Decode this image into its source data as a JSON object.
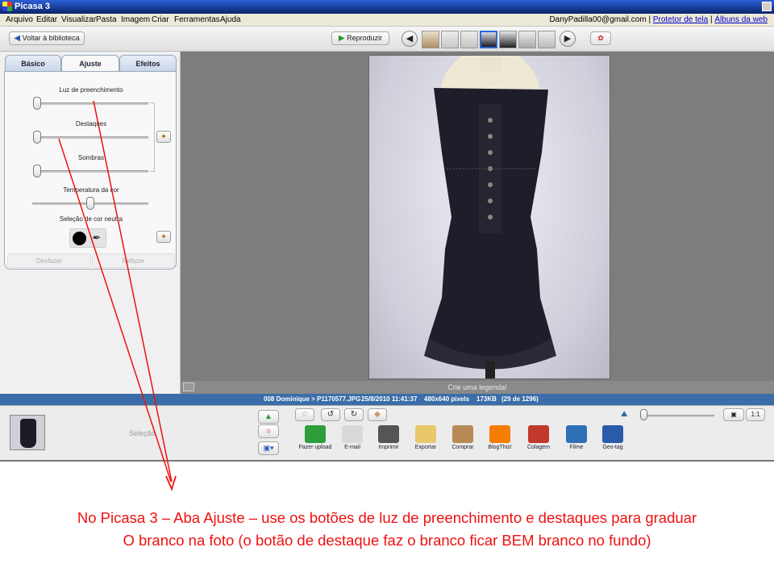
{
  "window": {
    "title": "Picasa 3"
  },
  "menu": {
    "items": [
      "Arquivo",
      "Editar",
      "Visualizar",
      "Pasta",
      "Imagem",
      "Criar",
      "Ferramentas",
      "Ajuda"
    ],
    "account": "DanyPadilla00@gmail.com",
    "screensaver_link": "Protetor de tela",
    "albums_link": "Álbuns da web",
    "separator": "|"
  },
  "toolbar": {
    "back_label": "Voltar à biblioteca",
    "play_label": "Reproduzir"
  },
  "tabs": [
    "Básico",
    "Ajuste",
    "Efeitos"
  ],
  "adjust": {
    "fill_light_label": "Luz de preenchimento",
    "highlights_label": "Destaques",
    "shadows_label": "Sombras",
    "temperature_label": "Temperatura da cor",
    "neutral_label": "Seleção de cor neutra",
    "undo_label": "Desfazer",
    "redo_label": "Refazer",
    "fill_light_value": 0.0,
    "highlights_value": 0.0,
    "shadows_value": 0.0,
    "temperature_value": 0.5
  },
  "caption": {
    "placeholder": "Crie uma legenda!"
  },
  "status": {
    "path": "008 Dominique > P1170577.JPG",
    "date": "25/8/2010 11:41:37",
    "dims": "480x640 pixels",
    "size": "173KB",
    "count": "(29 de 1296)"
  },
  "tray": {
    "selection_label": "Seleção"
  },
  "actions": [
    {
      "label": "Fazer upload",
      "icon": "upload-icon",
      "color": "#2e9e3a"
    },
    {
      "label": "E-mail",
      "icon": "email-icon",
      "color": "#d9d9d9"
    },
    {
      "label": "Imprimir",
      "icon": "printer-icon",
      "color": "#555555"
    },
    {
      "label": "Exportar",
      "icon": "folder-icon",
      "color": "#e8c86a"
    },
    {
      "label": "Comprar",
      "icon": "shop-icon",
      "color": "#b88a55"
    },
    {
      "label": "BlogThis!",
      "icon": "blogger-icon",
      "color": "#f57d00"
    },
    {
      "label": "Colagem",
      "icon": "collage-icon",
      "color": "#c0392b"
    },
    {
      "label": "Filme",
      "icon": "film-icon",
      "color": "#2f6fb5"
    },
    {
      "label": "Geo-tag",
      "icon": "globe-icon",
      "color": "#2b5aa8"
    }
  ],
  "annotation": {
    "line1": "No Picasa 3 – Aba Ajuste – use os botões de luz de preenchimento e destaques para graduar",
    "line2": "O branco na foto (o botão de destaque faz o branco ficar BEM branco no fundo)"
  },
  "colors": {
    "annotation": "#ee1111",
    "titlebar": "#0a246a",
    "statusbar": "#3b6ea8"
  }
}
